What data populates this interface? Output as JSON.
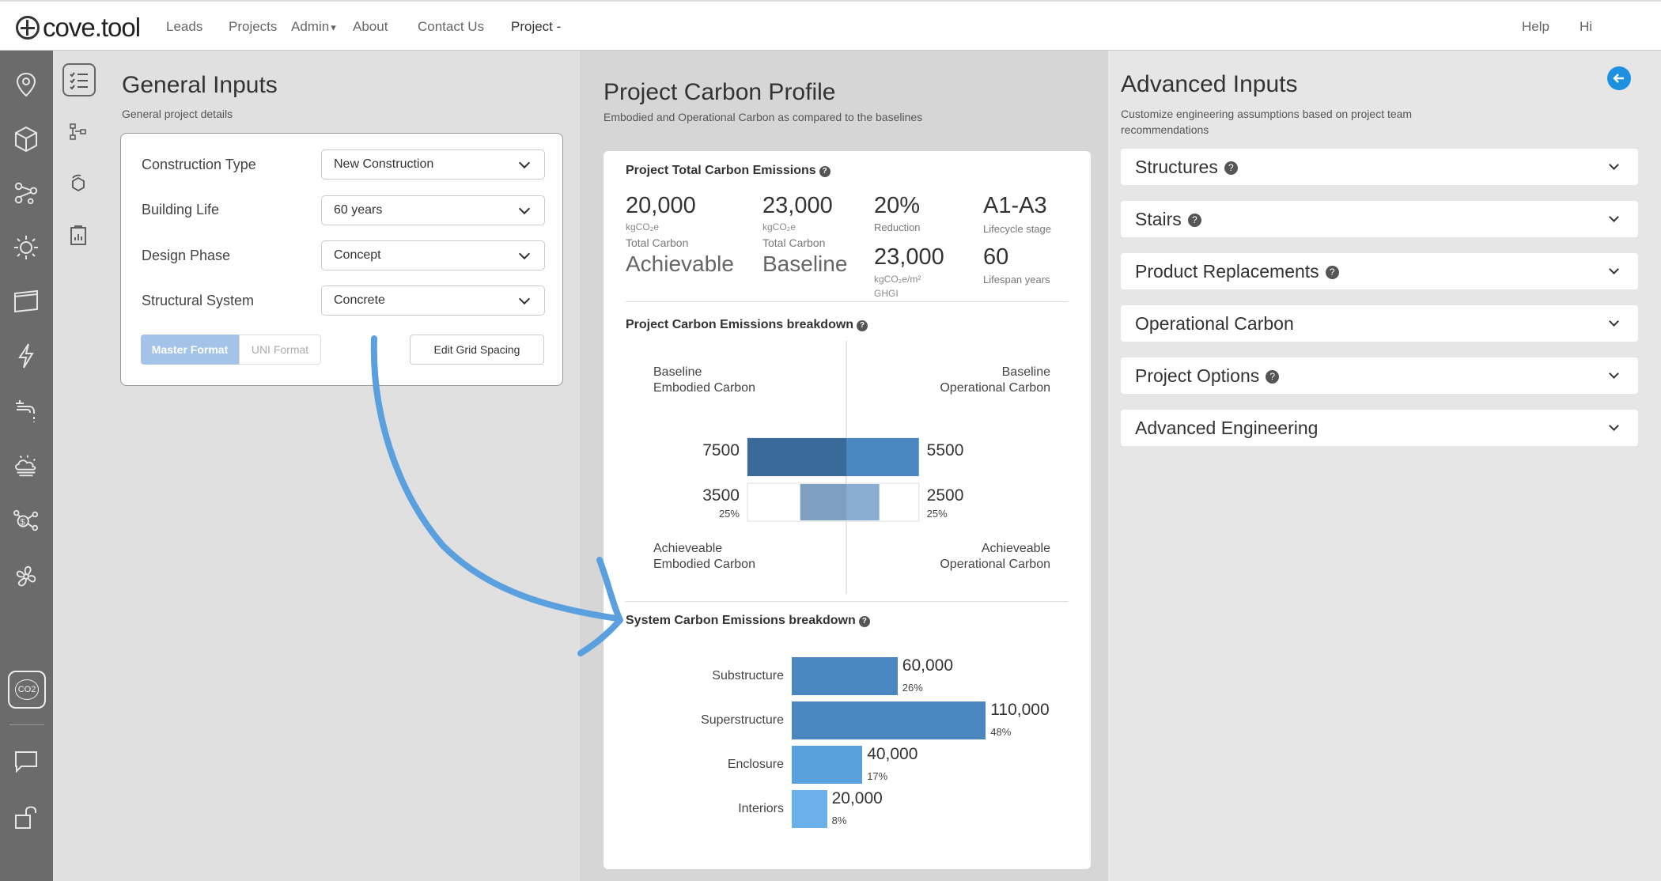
{
  "nav": {
    "logo": "cove.tool",
    "links": [
      "Leads",
      "Projects",
      "Admin",
      "About",
      "Contact Us"
    ],
    "project": "Project -",
    "help": "Help",
    "hi": "Hi"
  },
  "rail": {
    "icons": [
      "location-pin-icon",
      "cube-icon",
      "network-icon",
      "sun-icon",
      "window-icon",
      "lightning-icon",
      "faucet-icon",
      "weather-icon",
      "cost-icon",
      "fan-icon",
      "co2-icon",
      "chat-icon",
      "unlock-icon"
    ],
    "active_label": "CO2"
  },
  "general": {
    "title": "General Inputs",
    "subtitle": "General project details",
    "rows": [
      {
        "label": "Construction Type",
        "value": "New Construction"
      },
      {
        "label": "Building Life",
        "value": "60 years"
      },
      {
        "label": "Design Phase",
        "value": "Concept"
      },
      {
        "label": "Structural System",
        "value": "Concrete"
      }
    ],
    "buttons": {
      "master": "Master Format",
      "uni": "UNI Format",
      "grid": "Edit Grid Spacing"
    }
  },
  "profile": {
    "title": "Project Carbon Profile",
    "subtitle": "Embodied and Operational Carbon as compared to the baselines",
    "total_title": "Project Total Carbon Emissions",
    "help": "?",
    "stats": {
      "achievable_value": "20,000",
      "achievable_unit": "kgCO₂e",
      "achievable_caption": "Total Carbon",
      "achievable_word": "Achievable",
      "baseline_value": "23,000",
      "baseline_unit": "kgCO₂e",
      "baseline_caption": "Total Carbon",
      "baseline_word": "Baseline",
      "reduction_value": "20%",
      "reduction_caption": "Reduction",
      "ghg_value": "23,000",
      "ghg_unit": "kgCO₂e/m²",
      "ghg_caption": "GHGI",
      "stage_value": "A1-A3",
      "stage_caption": "Lifecycle stage",
      "lifespan_value": "60",
      "lifespan_caption": "Lifespan years"
    },
    "breakdown_title": "Project Carbon Emissions breakdown",
    "breakdown_labels": {
      "baseline_embodied": "Baseline\nEmbodied Carbon",
      "baseline_operational": "Baseline\nOperational Carbon",
      "achievable_embodied": "Achieveable\nEmbodied Carbon",
      "achievable_operational": "Achieveable\nOperational Carbon"
    },
    "system_title": "System Carbon Emissions breakdown"
  },
  "chart_data": [
    {
      "type": "bar",
      "title": "Project Carbon Emissions breakdown",
      "categories": [
        "Baseline",
        "Achieveable"
      ],
      "series": [
        {
          "name": "Embodied Carbon",
          "values": [
            7500,
            3500
          ],
          "pct_labels": [
            "",
            "25%"
          ]
        },
        {
          "name": "Operational Carbon",
          "values": [
            5500,
            2500
          ],
          "pct_labels": [
            "",
            "25%"
          ]
        }
      ],
      "colors": {
        "baseline_embodied": "#3a6a9a",
        "baseline_operational": "#4a86c0",
        "achievable_embodied": "#7d9fc0",
        "achievable_operational": "#8aaed3"
      }
    },
    {
      "type": "bar",
      "title": "System Carbon Emissions breakdown",
      "categories": [
        "Substructure",
        "Superstructure",
        "Enclosure",
        "Interiors"
      ],
      "values": [
        60000,
        110000,
        40000,
        20000
      ],
      "value_labels": [
        "60,000",
        "110,000",
        "40,000",
        "20,000"
      ],
      "pct_labels": [
        "26%",
        "48%",
        "17%",
        "8%"
      ],
      "colors": [
        "#4a86c0",
        "#4a86c0",
        "#5a9fde",
        "#6cb0ea"
      ]
    }
  ],
  "advanced": {
    "title": "Advanced Inputs",
    "subtitle": "Customize engineering assumptions based on project team recommendations",
    "sections": [
      {
        "label": "Structures",
        "help": true
      },
      {
        "label": "Stairs",
        "help": true
      },
      {
        "label": "Product Replacements",
        "help": true
      },
      {
        "label": "Operational Carbon",
        "help": false
      },
      {
        "label": "Project Options",
        "help": true
      },
      {
        "label": "Advanced Engineering",
        "help": false
      }
    ]
  },
  "colors": {
    "accent": "#1e90e0",
    "arrow": "#5a9fde",
    "rail": "#6b6b6b"
  }
}
